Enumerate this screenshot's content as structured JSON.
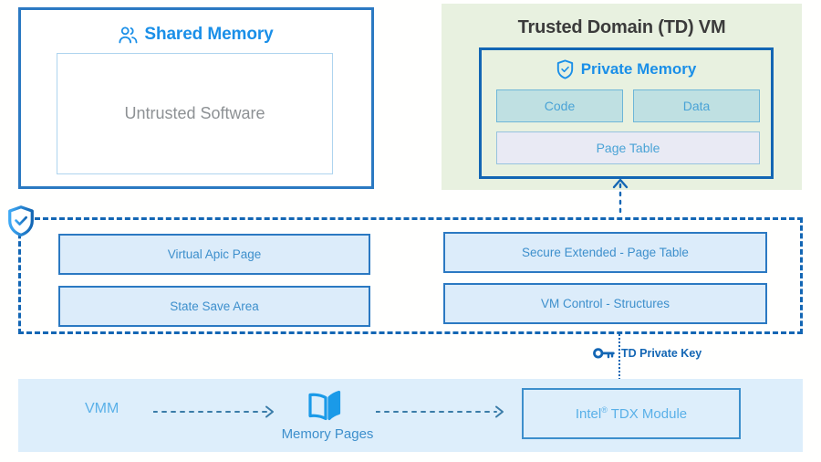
{
  "colors": {
    "primary_blue": "#1366b4",
    "bright_blue": "#1a8fe8",
    "light_blue_fill": "#dcecfa",
    "green_panel": "#e8f1e0",
    "teal_fill": "#bfe0e2",
    "lavender_fill": "#e9eaf4",
    "bottom_bar_fill": "#ddeefb",
    "muted_gray": "#8d9194"
  },
  "shared_memory": {
    "title": "Shared Memory",
    "icon": "users-icon",
    "inner_label": "Untrusted Software"
  },
  "trusted_domain_vm": {
    "title": "Trusted Domain (TD) VM",
    "private_memory": {
      "title": "Private Memory",
      "icon": "shield-check-icon",
      "cells": [
        {
          "label": "Code"
        },
        {
          "label": "Data"
        },
        {
          "label": "Page Table"
        }
      ]
    }
  },
  "secure_region": {
    "icon": "shield-check-icon",
    "boxes": [
      {
        "label": "Virtual Apic Page"
      },
      {
        "label": "State Save Area"
      },
      {
        "label": "Secure Extended - Page Table"
      },
      {
        "label": "VM Control - Structures"
      }
    ]
  },
  "td_private_key": {
    "label": "TD Private Key",
    "icon": "key-icon"
  },
  "vmm_bar": {
    "vmm_label": "VMM",
    "memory_pages": {
      "label": "Memory Pages",
      "icon": "open-book-icon"
    },
    "intel_tdx_module": {
      "label_main": "Intel",
      "label_sup": "®",
      "label_rest": " TDX Module"
    }
  }
}
